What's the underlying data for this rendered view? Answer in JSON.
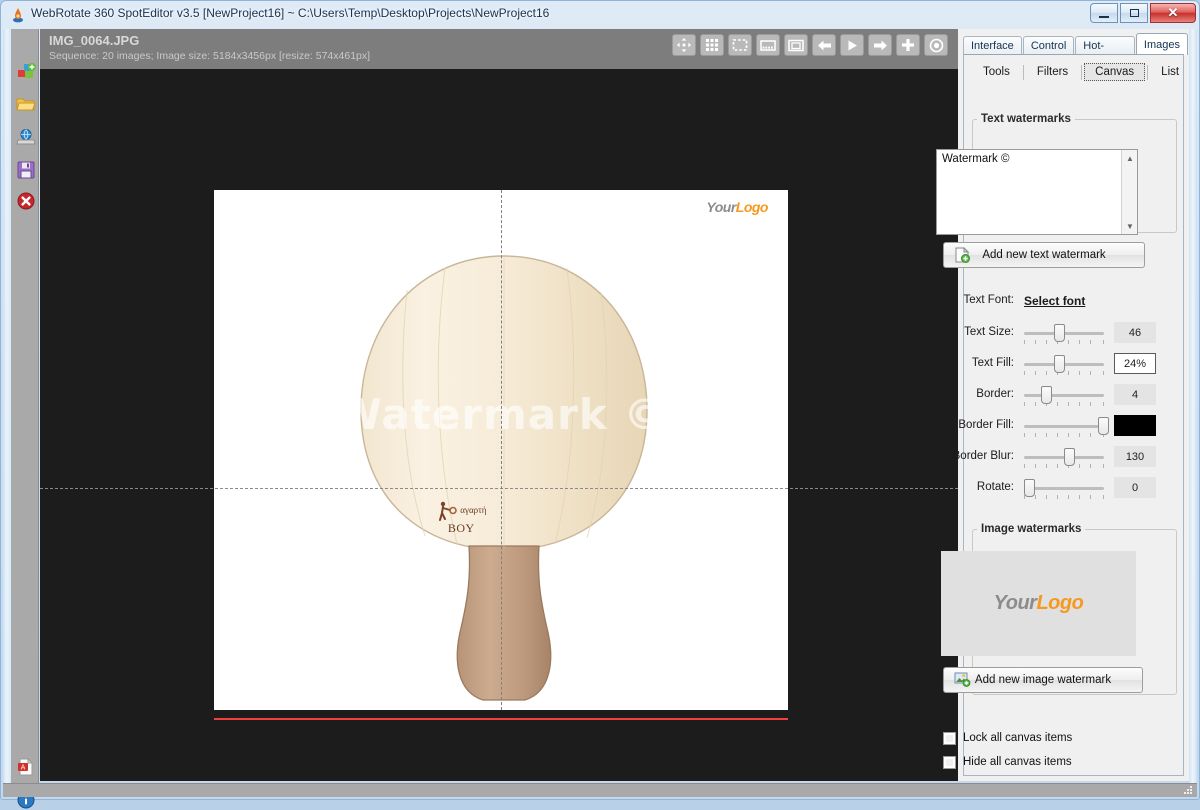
{
  "window": {
    "title": "WebRotate 360 SpotEditor v3.5 [NewProject16] ~ C:\\Users\\Temp\\Desktop\\Projects\\NewProject16",
    "icon": "app-icon",
    "controls": {
      "minimize": "–",
      "maximize": "□",
      "close": "✕"
    }
  },
  "sidebar": {
    "items": [
      {
        "name": "new-project",
        "icon": "new-project-icon"
      },
      {
        "name": "open-project",
        "icon": "folder-open-icon"
      },
      {
        "name": "publish",
        "icon": "publish-globe-icon"
      },
      {
        "name": "save-project",
        "icon": "save-floppy-icon"
      },
      {
        "name": "close-project",
        "icon": "close-red-icon"
      },
      {
        "name": "documentation",
        "icon": "pdf-doc-icon"
      },
      {
        "name": "about",
        "icon": "info-icon"
      }
    ]
  },
  "image_header": {
    "filename": "IMG_0064.JPG",
    "meta": "Sequence: 20 images; Image size: 5184x3456px [resize: 574x461px]"
  },
  "toolbar": {
    "buttons": [
      {
        "name": "pan-tool",
        "icon": "move-arrows-icon"
      },
      {
        "name": "grid-view",
        "icon": "grid-icon"
      },
      {
        "name": "marquee-select",
        "icon": "dashed-rect-icon"
      },
      {
        "name": "filmstrip",
        "icon": "filmstrip-icon"
      },
      {
        "name": "single-frame",
        "icon": "frame-icon"
      },
      {
        "name": "previous-image",
        "icon": "arrow-left-icon"
      },
      {
        "name": "play-sequence",
        "icon": "play-icon"
      },
      {
        "name": "next-image",
        "icon": "arrow-right-icon"
      },
      {
        "name": "add-image",
        "icon": "plus-icon"
      },
      {
        "name": "record-spot",
        "icon": "target-icon"
      }
    ]
  },
  "canvas": {
    "watermark_text": "Watermark ©",
    "logo_prefix": "Your",
    "logo_suffix": "Logo",
    "brand_small": "αγαρτή",
    "brand_big": "BOY",
    "guide_color": "#808080",
    "marker_color": "#f04040"
  },
  "tabs": [
    {
      "label": "Interface",
      "active": false
    },
    {
      "label": "Control",
      "active": false
    },
    {
      "label": "Hot-spots",
      "active": false
    },
    {
      "label": "Images",
      "active": true
    }
  ],
  "subtabs": [
    {
      "label": "Tools",
      "selected": false
    },
    {
      "label": "Filters",
      "selected": false
    },
    {
      "label": "Canvas",
      "selected": true
    },
    {
      "label": "List",
      "selected": false
    }
  ],
  "text_watermarks": {
    "group_label": "Text watermarks",
    "list": [
      "Watermark ©"
    ],
    "add_button": "Add new text watermark",
    "scroll_up": "▲",
    "scroll_down": "▼",
    "font_label": "Text Font:",
    "font_link": "Select font",
    "sliders": [
      {
        "label": "Text Size:",
        "value": "46",
        "pos": 38,
        "highlight": false,
        "swatch": false
      },
      {
        "label": "Text Fill:",
        "value": "24%",
        "pos": 38,
        "highlight": true,
        "swatch": false
      },
      {
        "label": "Border:",
        "value": "4",
        "pos": 22,
        "highlight": false,
        "swatch": false
      },
      {
        "label": "Border Fill:",
        "value": "",
        "pos": 86,
        "highlight": false,
        "swatch": true,
        "color": "#000000"
      },
      {
        "label": "Border Blur:",
        "value": "130",
        "pos": 50,
        "highlight": false,
        "swatch": false
      },
      {
        "label": "Rotate:",
        "value": "0",
        "pos": 2,
        "highlight": false,
        "swatch": false
      }
    ]
  },
  "image_watermarks": {
    "group_label": "Image watermarks",
    "preview_prefix": "Your",
    "preview_suffix": "Logo",
    "add_button": "Add new image watermark"
  },
  "options": [
    {
      "label": "Lock all canvas items",
      "checked": false
    },
    {
      "label": "Hide all canvas items",
      "checked": false
    }
  ]
}
